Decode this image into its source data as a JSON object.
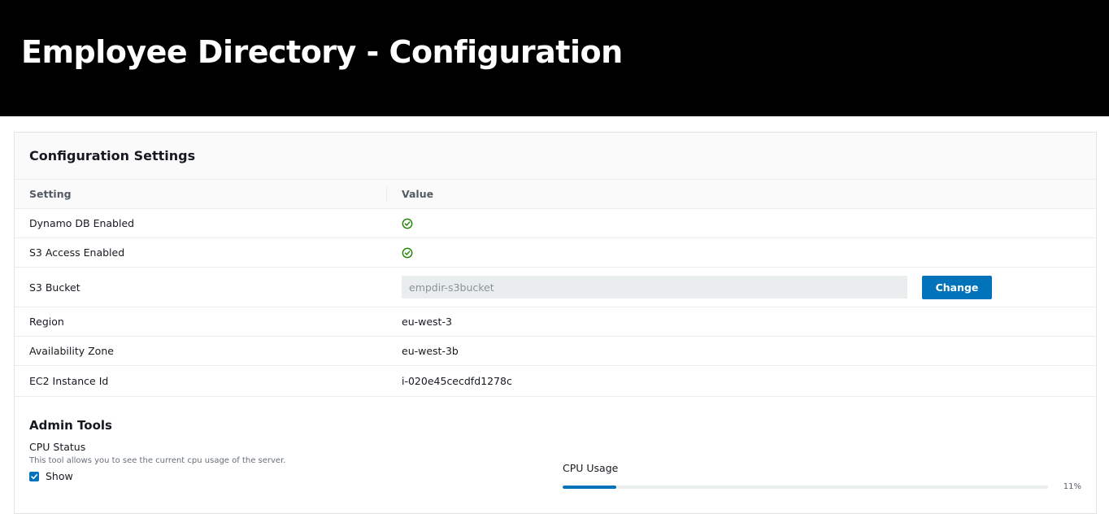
{
  "header": {
    "title": "Employee Directory - Configuration"
  },
  "panel": {
    "title": "Configuration Settings",
    "columns": {
      "setting": "Setting",
      "value": "Value"
    },
    "rows": [
      {
        "setting": "Dynamo DB Enabled",
        "status": "enabled",
        "icon": "check-circle-icon"
      },
      {
        "setting": "S3 Access Enabled",
        "status": "enabled",
        "icon": "check-circle-icon"
      },
      {
        "setting": "S3 Bucket",
        "input_value": "empdir-s3bucket",
        "button_label": "Change"
      },
      {
        "setting": "Region",
        "value": "eu-west-3"
      },
      {
        "setting": "Availability Zone",
        "value": "eu-west-3b"
      },
      {
        "setting": "EC2 Instance Id",
        "value": "i-020e45cecdfd1278c"
      }
    ]
  },
  "admin": {
    "title": "Admin Tools",
    "cpu_status": {
      "label": "CPU Status",
      "description": "This tool allows you to see the current cpu usage of the server.",
      "show_label": "Show",
      "show_checked": true
    },
    "cpu_usage": {
      "label": "CPU Usage",
      "percent": 11,
      "percent_text": "11%"
    }
  },
  "colors": {
    "header_bg": "#000000",
    "accent": "#0073bb",
    "success": "#1d8102"
  }
}
